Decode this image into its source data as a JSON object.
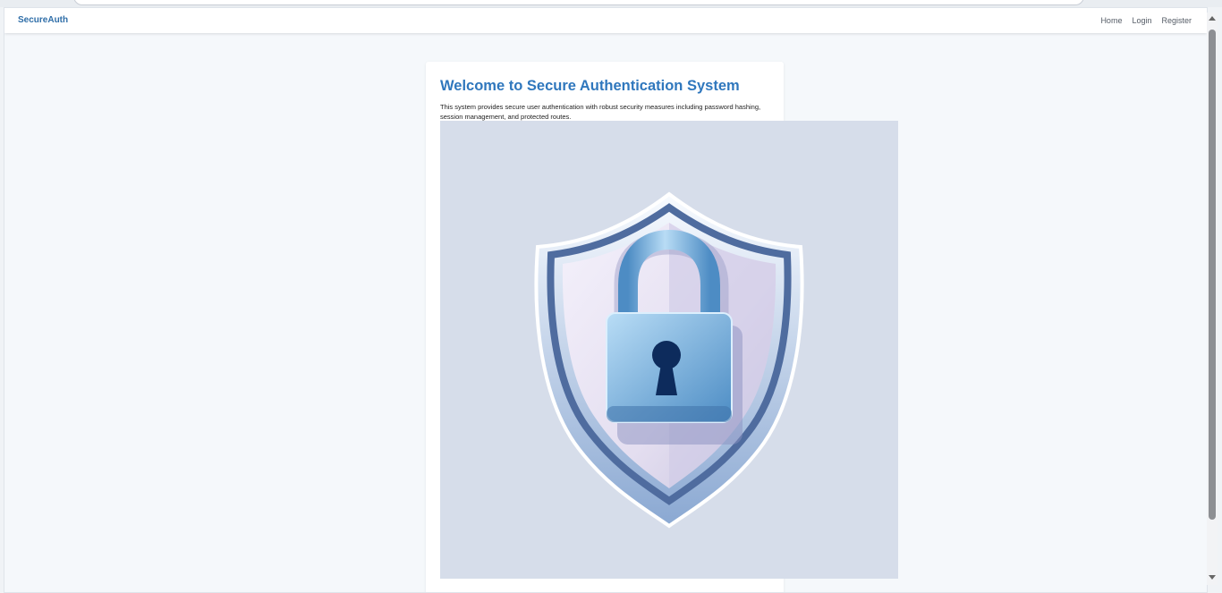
{
  "navbar": {
    "brand": "SecureAuth",
    "links": [
      "Home",
      "Login",
      "Register"
    ]
  },
  "main": {
    "title": "Welcome to Secure Authentication System",
    "intro": "This system provides secure user authentication with robust security measures including password hashing, session management, and protected routes.",
    "hero": {
      "icon": "shield-lock-icon",
      "background_color": "#d6ddea"
    }
  },
  "colors": {
    "brand": "#2f6ea8",
    "title": "#2f77bd"
  }
}
